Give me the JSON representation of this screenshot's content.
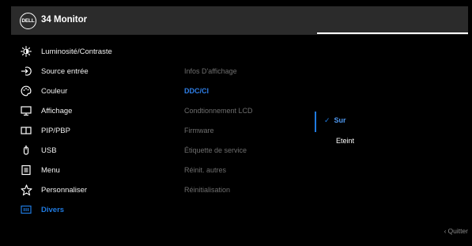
{
  "header": {
    "logo_text": "DELL",
    "title": "34 Monitor"
  },
  "menu": {
    "items": [
      {
        "label": "Luminosité/Contraste",
        "icon": "brightness-icon"
      },
      {
        "label": "Source entrée",
        "icon": "input-source-icon"
      },
      {
        "label": "Couleur",
        "icon": "palette-icon"
      },
      {
        "label": "Affichage",
        "icon": "display-icon"
      },
      {
        "label": "PIP/PBP",
        "icon": "pip-icon"
      },
      {
        "label": "USB",
        "icon": "usb-icon"
      },
      {
        "label": "Menu",
        "icon": "menu-icon"
      },
      {
        "label": "Personnaliser",
        "icon": "star-icon"
      },
      {
        "label": "Divers",
        "icon": "info-icon"
      }
    ],
    "active_index": 8
  },
  "submenu": {
    "items": [
      {
        "label": "Infos D'affichage"
      },
      {
        "label": "DDC/CI"
      },
      {
        "label": "Condtionnement LCD"
      },
      {
        "label": "Firmware"
      },
      {
        "label": "Étiquette de service"
      },
      {
        "label": "Réinit. autres"
      },
      {
        "label": "Réinitialisation"
      }
    ],
    "active_index": 1
  },
  "options": {
    "items": [
      {
        "label": "Sur",
        "selected": true
      },
      {
        "label": "Eteint",
        "selected": false
      }
    ]
  },
  "footer": {
    "quit_label": "Quitter"
  },
  "colors": {
    "accent": "#1f7ae0",
    "header_bg": "#2b2b2b",
    "background": "#000000",
    "submenu_text": "#6f6f6f"
  }
}
